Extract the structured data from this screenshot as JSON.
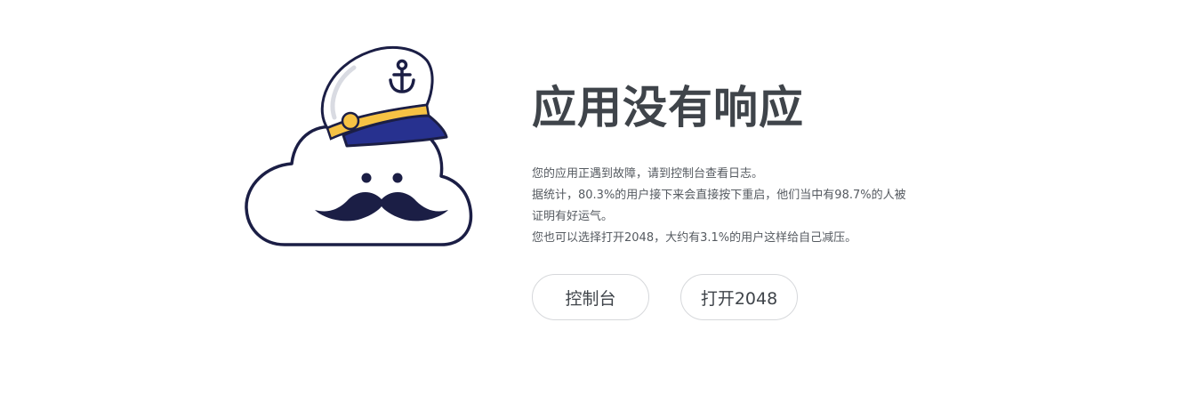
{
  "error": {
    "title": "应用没有响应",
    "lines": [
      "您的应用正遇到故障，请到控制台查看日志。",
      "据统计，80.3%的用户接下来会直接按下重启，他们当中有98.7%的人被",
      "证明有好运气。",
      "您也可以选择打开2048，大约有3.1%的用户这样给自己减压。"
    ]
  },
  "actions": {
    "console_label": "控制台",
    "game_label": "打开2048"
  },
  "illustration": {
    "subject": "cloud-captain-mascot",
    "colors": {
      "outline": "#1b1e45",
      "hat_band": "#27318f",
      "gold": "#f6c244",
      "mustache": "#1b1e45"
    }
  }
}
